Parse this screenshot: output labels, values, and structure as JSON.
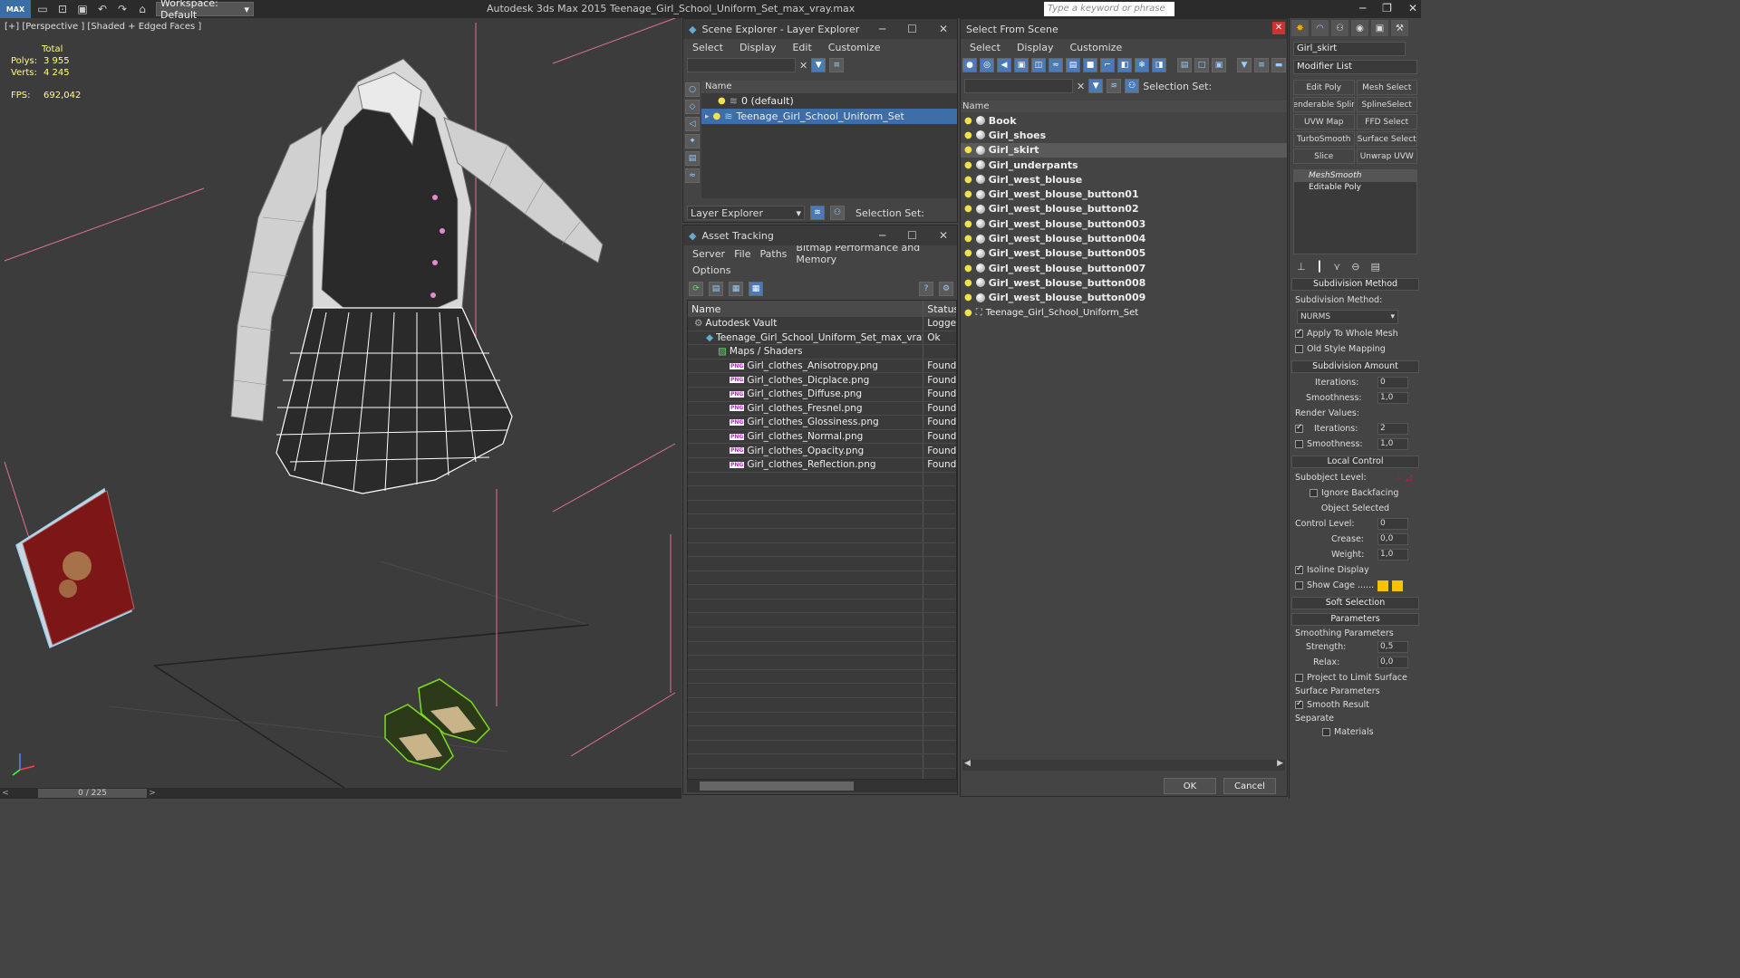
{
  "titlebar": {
    "logo": "MAX",
    "workspace": "Workspace: Default",
    "app_title": "Autodesk 3ds Max  2015     Teenage_Girl_School_Uniform_Set_max_vray.max",
    "search_placeholder": "Type a keyword or phrase"
  },
  "viewport": {
    "label": "[+] [Perspective ] [Shaded + Edged Faces ]",
    "stats_total": "Total",
    "polys_label": "Polys:",
    "polys_value": "3 955",
    "verts_label": "Verts:",
    "verts_value": "4 245",
    "fps_label": "FPS:",
    "fps_value": "692,042"
  },
  "timeline": {
    "frame": "0 / 225"
  },
  "scene_explorer": {
    "title": "Scene Explorer - Layer Explorer",
    "menu": [
      "Select",
      "Display",
      "Edit",
      "Customize"
    ],
    "column": "Name",
    "rows": [
      "0 (default)",
      "Teenage_Girl_School_Uniform_Set"
    ],
    "footer_combo": "Layer Explorer",
    "selection_set": "Selection Set:"
  },
  "asset_tracking": {
    "title": "Asset Tracking",
    "menu": [
      "Server",
      "File",
      "Paths",
      "Bitmap Performance and Memory"
    ],
    "menu2": "Options",
    "col_name": "Name",
    "col_status": "Status",
    "rows": [
      {
        "name": "Autodesk Vault",
        "status": "Logged",
        "indent": 1
      },
      {
        "name": "Teenage_Girl_School_Uniform_Set_max_vray.max",
        "status": "Ok",
        "indent": 2
      },
      {
        "name": "Maps / Shaders",
        "status": "",
        "indent": 3
      },
      {
        "name": "Girl_clothes_Anisotropy.png",
        "status": "Found",
        "indent": 4
      },
      {
        "name": "Girl_clothes_Dicplace.png",
        "status": "Found",
        "indent": 4
      },
      {
        "name": "Girl_clothes_Diffuse.png",
        "status": "Found",
        "indent": 4
      },
      {
        "name": "Girl_clothes_Fresnel.png",
        "status": "Found",
        "indent": 4
      },
      {
        "name": "Girl_clothes_Glossiness.png",
        "status": "Found",
        "indent": 4
      },
      {
        "name": "Girl_clothes_Normal.png",
        "status": "Found",
        "indent": 4
      },
      {
        "name": "Girl_clothes_Opacity.png",
        "status": "Found",
        "indent": 4
      },
      {
        "name": "Girl_clothes_Reflection.png",
        "status": "Found",
        "indent": 4
      }
    ]
  },
  "select_from_scene": {
    "title": "Select From Scene",
    "menu": [
      "Select",
      "Display",
      "Customize"
    ],
    "selection_set": "Selection Set:",
    "column": "Name",
    "items": [
      "Book",
      "Girl_shoes",
      "Girl_skirt",
      "Girl_underpants",
      "Girl_west_blouse",
      "Girl_west_blouse_button01",
      "Girl_west_blouse_button02",
      "Girl_west_blouse_button003",
      "Girl_west_blouse_button004",
      "Girl_west_blouse_button005",
      "Girl_west_blouse_button007",
      "Girl_west_blouse_button008",
      "Girl_west_blouse_button009"
    ],
    "group_item": "Teenage_Girl_School_Uniform_Set",
    "selected": "Girl_skirt",
    "ok": "OK",
    "cancel": "Cancel"
  },
  "command_panel": {
    "object_name": "Girl_skirt",
    "modifier_list": "Modifier List",
    "buttons": [
      "Edit Poly",
      "Mesh Select",
      "enderable Splir",
      "SplineSelect",
      "UVW Map",
      "FFD Select",
      "TurboSmooth",
      "Surface Select",
      "Slice",
      "Unwrap UVW"
    ],
    "stack": [
      "MeshSmooth",
      "Editable Poly"
    ],
    "subdiv_method_title": "Subdivision Method",
    "subdiv_method_label": "Subdivision Method:",
    "subdiv_method_value": "NURMS",
    "apply_whole": "Apply To Whole Mesh",
    "old_style": "Old Style Mapping",
    "subdiv_amount_title": "Subdivision Amount",
    "iterations_label": "Iterations:",
    "iterations_value": "0",
    "smoothness_label": "Smoothness:",
    "smoothness_value": "1,0",
    "render_values": "Render Values:",
    "r_iterations_value": "2",
    "r_smoothness_value": "1,0",
    "local_control_title": "Local Control",
    "subobject_level": "Subobject Level:",
    "ignore_backfacing": "Ignore Backfacing",
    "object_selected": "Object Selected",
    "control_level_label": "Control Level:",
    "control_level_value": "0",
    "crease_label": "Crease:",
    "crease_value": "0,0",
    "weight_label": "Weight:",
    "weight_value": "1,0",
    "isoline": "Isoline Display",
    "show_cage": "Show Cage ......",
    "soft_selection_title": "Soft Selection",
    "parameters_title": "Parameters",
    "smoothing_params": "Smoothing Parameters",
    "strength_label": "Strength:",
    "strength_value": "0,5",
    "relax_label": "Relax:",
    "relax_value": "0,0",
    "project_limit": "Project to Limit Surface",
    "surface_params": "Surface Parameters",
    "smooth_result": "Smooth Result",
    "separate": "Separate",
    "materials": "Materials"
  },
  "colors": {
    "selection_blue": "#3d6ea8",
    "stat_yellow": "#ffff80",
    "cage_yellow": "#f5c400",
    "shoe_green": "#7cdc1e"
  }
}
